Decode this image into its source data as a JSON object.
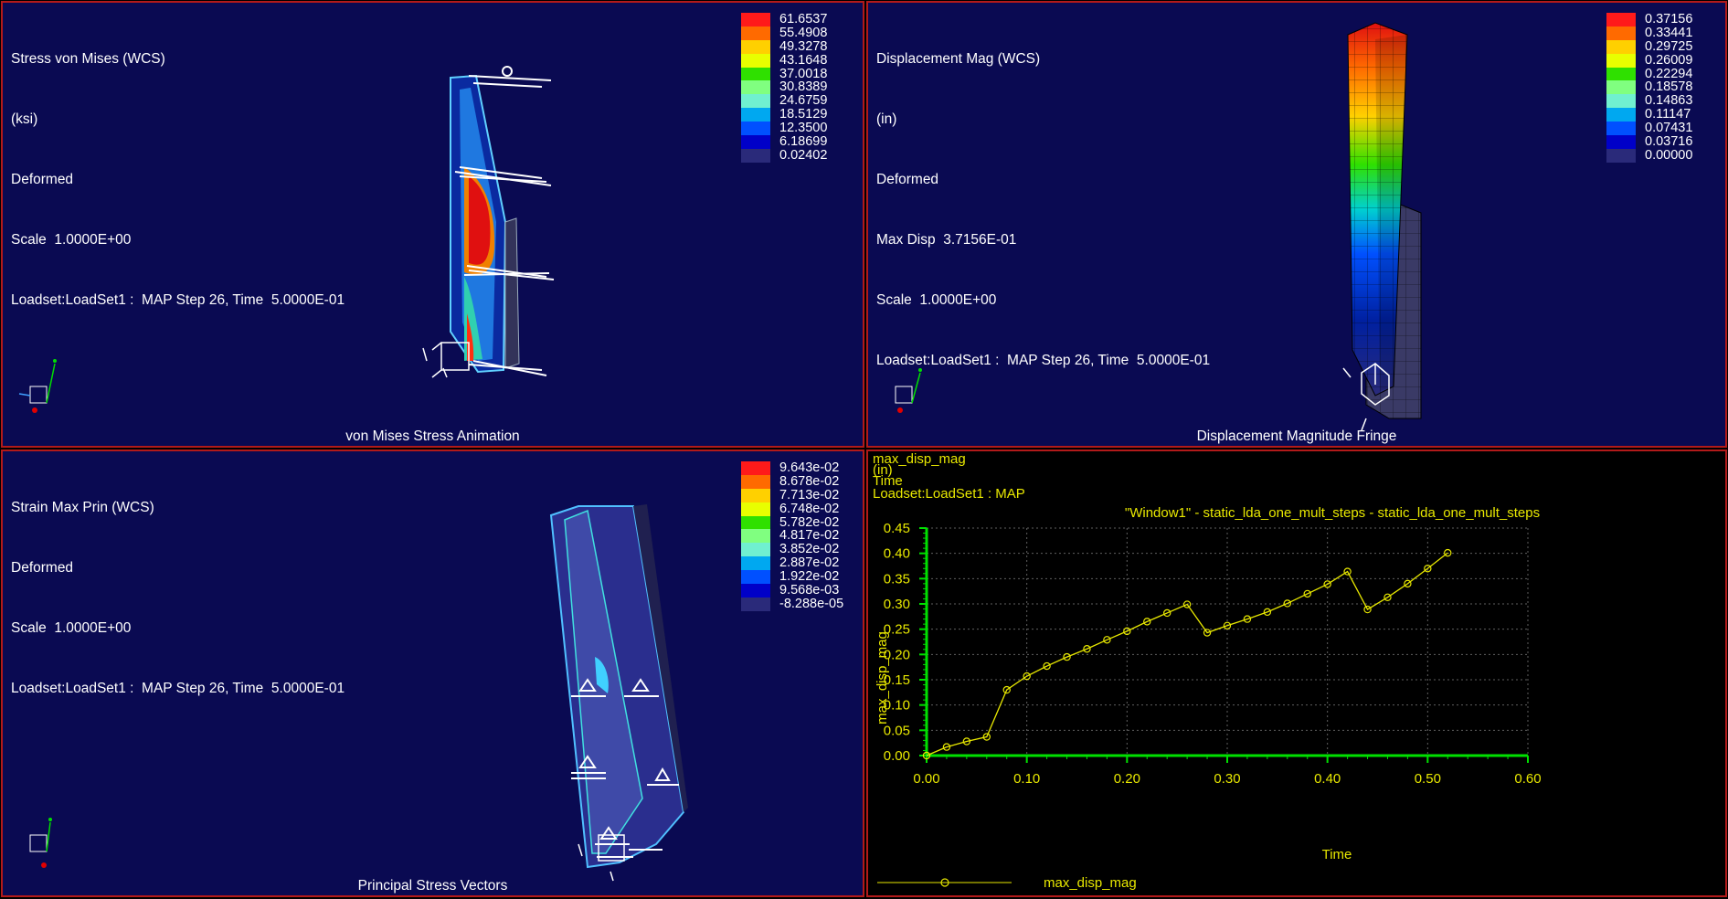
{
  "viewports": [
    {
      "header": [
        "Stress von Mises (WCS)",
        "(ksi)",
        "Deformed",
        "Scale  1.0000E+00",
        "Loadset:LoadSet1 :  MAP Step 26, Time  5.0000E-01"
      ],
      "caption": "von Mises Stress Animation",
      "legend": [
        "61.6537",
        "55.4908",
        "49.3278",
        "43.1648",
        "37.0018",
        "30.8389",
        "24.6759",
        "18.5129",
        "12.3500",
        "6.18699",
        "0.02402"
      ]
    },
    {
      "header": [
        "Displacement Mag (WCS)",
        "(in)",
        "Deformed",
        "Max Disp  3.7156E-01",
        "Scale  1.0000E+00",
        "Loadset:LoadSet1 :  MAP Step 26, Time  5.0000E-01"
      ],
      "caption": "Displacement Magnitude Fringe",
      "legend": [
        "0.37156",
        "0.33441",
        "0.29725",
        "0.26009",
        "0.22294",
        "0.18578",
        "0.14863",
        "0.11147",
        "0.07431",
        "0.03716",
        "0.00000"
      ]
    },
    {
      "header": [
        "Strain Max Prin (WCS)",
        "Deformed",
        "Scale  1.0000E+00",
        "Loadset:LoadSet1 :  MAP Step 26, Time  5.0000E-01"
      ],
      "caption": "Principal Stress Vectors",
      "legend": [
        "9.643e-02",
        "8.678e-02",
        "7.713e-02",
        "6.748e-02",
        "5.782e-02",
        "4.817e-02",
        "3.852e-02",
        "2.887e-02",
        "1.922e-02",
        "9.568e-03",
        "-8.288e-05"
      ]
    }
  ],
  "legend_colors": [
    "#ff1a1a",
    "#ff6a00",
    "#ffd000",
    "#e8ff00",
    "#2fe000",
    "#80ff80",
    "#70f0d0",
    "#00a8f0",
    "#0050ff",
    "#0000c8",
    "#2a2a7a"
  ],
  "graph": {
    "header": [
      "max_disp_mag",
      "(in)",
      "Time",
      "Loadset:LoadSet1 :  MAP"
    ],
    "legend_label": "max_disp_mag",
    "colors": {
      "axis": "#00e000",
      "curve": "#e8e800",
      "grid": "#606060"
    }
  },
  "chart_data": {
    "type": "line",
    "title": "\"Window1\" - static_lda_one_mult_steps - static_lda_one_mult_steps",
    "xlabel": "Time",
    "ylabel": "max_disp_mag",
    "xlim": [
      0,
      0.6
    ],
    "ylim": [
      0,
      0.45
    ],
    "xticks": [
      "0.00",
      "0.10",
      "0.20",
      "0.30",
      "0.40",
      "0.50",
      "0.60"
    ],
    "yticks": [
      "0.00",
      "0.05",
      "0.10",
      "0.15",
      "0.20",
      "0.25",
      "0.30",
      "0.35",
      "0.40",
      "0.45"
    ],
    "grid": true,
    "legend_position": "bottom-left",
    "series": [
      {
        "name": "max_disp_mag",
        "x": [
          0.0,
          0.02,
          0.04,
          0.06,
          0.08,
          0.1,
          0.12,
          0.14,
          0.16,
          0.18,
          0.2,
          0.22,
          0.24,
          0.26,
          0.28,
          0.3,
          0.32,
          0.34,
          0.36,
          0.38,
          0.4,
          0.42,
          0.44,
          0.46,
          0.48,
          0.5,
          0.52
        ],
        "y": [
          0.0,
          0.017,
          0.028,
          0.037,
          0.13,
          0.157,
          0.177,
          0.195,
          0.211,
          0.229,
          0.246,
          0.265,
          0.282,
          0.299,
          0.243,
          0.257,
          0.27,
          0.284,
          0.301,
          0.32,
          0.339,
          0.364,
          0.289,
          0.313,
          0.34,
          0.37,
          0.401
        ]
      }
    ]
  }
}
